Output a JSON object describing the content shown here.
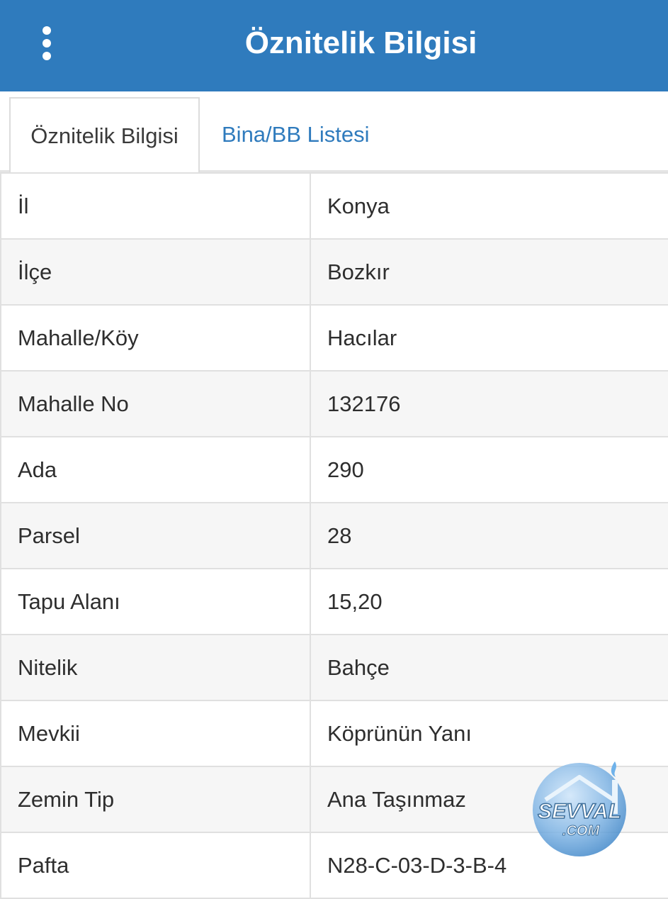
{
  "header": {
    "title": "Öznitelik Bilgisi",
    "menu_icon": "more-vertical-icon"
  },
  "tabs": [
    {
      "label": "Öznitelik Bilgisi",
      "active": true
    },
    {
      "label": "Bina/BB Listesi",
      "active": false
    }
  ],
  "rows": [
    {
      "label": "İl",
      "value": "Konya"
    },
    {
      "label": "İlçe",
      "value": "Bozkır"
    },
    {
      "label": "Mahalle/Köy",
      "value": "Hacılar"
    },
    {
      "label": "Mahalle No",
      "value": "132176"
    },
    {
      "label": "Ada",
      "value": "290"
    },
    {
      "label": "Parsel",
      "value": "28"
    },
    {
      "label": "Tapu Alanı",
      "value": "15,20"
    },
    {
      "label": "Nitelik",
      "value": "Bahçe"
    },
    {
      "label": "Mevkii",
      "value": "Köprünün Yanı"
    },
    {
      "label": "Zemin Tip",
      "value": "Ana Taşınmaz"
    },
    {
      "label": "Pafta",
      "value": "N28-C-03-D-3-B-4"
    }
  ],
  "watermark": {
    "text_main": "SEVVAL",
    "text_sub": ".COM"
  },
  "colors": {
    "primary": "#2f7bbd",
    "text": "#2e2e2e",
    "border": "#e0e0e0"
  }
}
